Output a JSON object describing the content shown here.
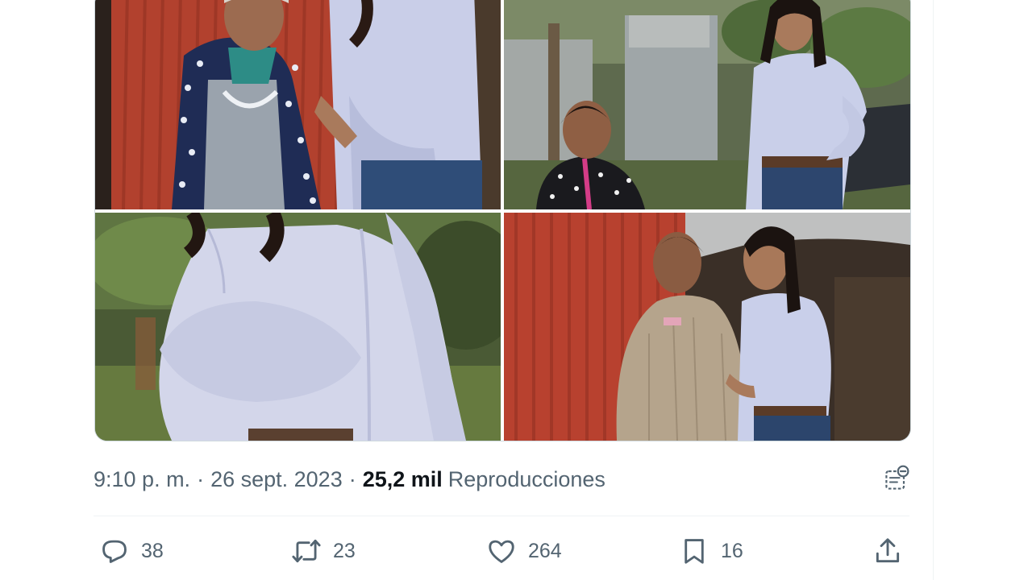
{
  "tweet": {
    "media": [
      {
        "alt": ""
      },
      {
        "alt": ""
      },
      {
        "alt": ""
      },
      {
        "alt": ""
      }
    ],
    "meta": {
      "time": "9:10 p. m.",
      "separator": "·",
      "date": "26 sept. 2023",
      "views_count": "25,2 mil",
      "views_label": "Reproducciones"
    },
    "actions": {
      "replies": "38",
      "retweets": "23",
      "likes": "264",
      "bookmarks": "16"
    },
    "icons": {
      "reply": "reply-icon",
      "retweet": "retweet-icon",
      "like": "heart-icon",
      "bookmark": "bookmark-icon",
      "share": "share-icon",
      "analytics": "post-analytics-icon"
    },
    "colors": {
      "text_primary": "#0f1419",
      "text_secondary": "#536471",
      "border": "#cfd9de",
      "divider": "#eff3f4"
    }
  }
}
